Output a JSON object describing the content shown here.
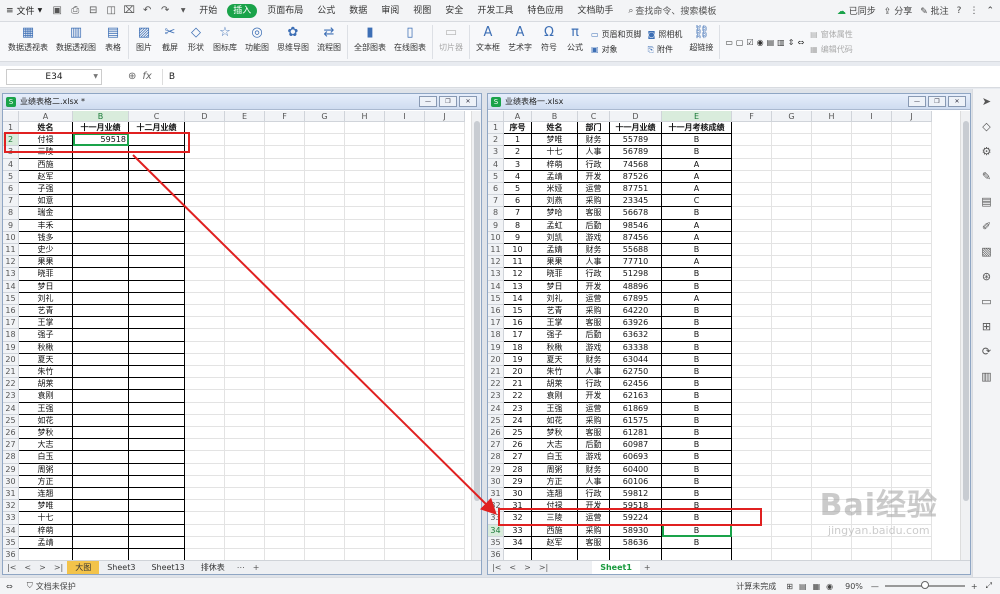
{
  "menubar": {
    "file_label": "文件",
    "tabs": [
      "开始",
      "插入",
      "页面布局",
      "公式",
      "数据",
      "审阅",
      "视图",
      "安全",
      "开发工具",
      "特色应用",
      "文档助手"
    ],
    "active_tab": "插入",
    "search_label": "查找命令、搜索模板",
    "sync_label": "已同步",
    "share_label": "分享",
    "comment_label": "批注"
  },
  "ribbon": {
    "buttons": [
      "数据透视表",
      "数据透视图",
      "表格",
      "图片",
      "截屏",
      "形状",
      "图标库",
      "功能图",
      "思维导图",
      "流程图",
      "全部图表",
      "在线图表",
      "切片器",
      "文本框",
      "艺术字",
      "符号",
      "公式"
    ],
    "small_items": [
      "页眉和页脚",
      "对象",
      "照相机",
      "附件",
      "超链接",
      "窗体属性",
      "编辑代码"
    ]
  },
  "formula_bar": {
    "cell_ref": "E34",
    "value": "B"
  },
  "left_window": {
    "title": "业绩表格二.xlsx *",
    "col_letters": [
      "A",
      "B",
      "C",
      "D",
      "E",
      "F",
      "G",
      "H",
      "I",
      "J"
    ],
    "headers": [
      "姓名",
      "十一月业绩",
      "十二月业绩"
    ],
    "rows": [
      [
        "付禄",
        "59518"
      ],
      [
        "三陵",
        ""
      ],
      [
        "西施",
        ""
      ],
      [
        "赵军",
        ""
      ],
      [
        "子强",
        ""
      ],
      [
        "如意",
        ""
      ],
      [
        "瑞金",
        ""
      ],
      [
        "丰禾",
        ""
      ],
      [
        "钱多",
        ""
      ],
      [
        "史少",
        ""
      ],
      [
        "果果",
        ""
      ],
      [
        "晓菲",
        ""
      ],
      [
        "梦日",
        ""
      ],
      [
        "刘礼",
        ""
      ],
      [
        "艺青",
        ""
      ],
      [
        "王掌",
        ""
      ],
      [
        "强子",
        ""
      ],
      [
        "秋楸",
        ""
      ],
      [
        "夏天",
        ""
      ],
      [
        "朱竹",
        ""
      ],
      [
        "胡莱",
        ""
      ],
      [
        "袁刚",
        ""
      ],
      [
        "王强",
        ""
      ],
      [
        "如花",
        ""
      ],
      [
        "梦秋",
        ""
      ],
      [
        "大志",
        ""
      ],
      [
        "白玉",
        ""
      ],
      [
        "周粥",
        ""
      ],
      [
        "方正",
        ""
      ],
      [
        "连翘",
        ""
      ],
      [
        "梦唯",
        ""
      ],
      [
        "十七",
        ""
      ],
      [
        "梓萌",
        ""
      ],
      [
        "孟靖",
        ""
      ]
    ],
    "sheet_tabs": [
      "大图",
      "Sheet3",
      "Sheet13",
      "排休表"
    ],
    "active_sheet": "大图"
  },
  "right_window": {
    "title": "业绩表格一.xlsx",
    "col_letters": [
      "A",
      "B",
      "C",
      "D",
      "E",
      "F",
      "G",
      "H",
      "I",
      "J"
    ],
    "headers": [
      "序号",
      "姓名",
      "部门",
      "十一月业绩",
      "十一月考核成绩"
    ],
    "rows": [
      [
        "1",
        "梦唯",
        "财务",
        "55789",
        "B"
      ],
      [
        "2",
        "十七",
        "人事",
        "56789",
        "B"
      ],
      [
        "3",
        "梓萌",
        "行政",
        "74568",
        "A"
      ],
      [
        "4",
        "孟靖",
        "开发",
        "87526",
        "A"
      ],
      [
        "5",
        "米娅",
        "运营",
        "87751",
        "A"
      ],
      [
        "6",
        "刘燕",
        "采购",
        "23345",
        "C"
      ],
      [
        "7",
        "梦哈",
        "客服",
        "56678",
        "B"
      ],
      [
        "8",
        "孟虹",
        "后勤",
        "98546",
        "A"
      ],
      [
        "9",
        "刘凯",
        "游戏",
        "87456",
        "A"
      ],
      [
        "10",
        "孟婧",
        "财务",
        "55688",
        "B"
      ],
      [
        "11",
        "果果",
        "人事",
        "77710",
        "A"
      ],
      [
        "12",
        "晓菲",
        "行政",
        "51298",
        "B"
      ],
      [
        "13",
        "梦日",
        "开发",
        "48896",
        "B"
      ],
      [
        "14",
        "刘礼",
        "运营",
        "67895",
        "A"
      ],
      [
        "15",
        "艺青",
        "采购",
        "64220",
        "B"
      ],
      [
        "16",
        "王掌",
        "客服",
        "63926",
        "B"
      ],
      [
        "17",
        "强子",
        "后勤",
        "63632",
        "B"
      ],
      [
        "18",
        "秋楸",
        "游戏",
        "63338",
        "B"
      ],
      [
        "19",
        "夏天",
        "财务",
        "63044",
        "B"
      ],
      [
        "20",
        "朱竹",
        "人事",
        "62750",
        "B"
      ],
      [
        "21",
        "胡莱",
        "行政",
        "62456",
        "B"
      ],
      [
        "22",
        "袁刚",
        "开发",
        "62163",
        "B"
      ],
      [
        "23",
        "王强",
        "运营",
        "61869",
        "B"
      ],
      [
        "24",
        "如花",
        "采购",
        "61575",
        "B"
      ],
      [
        "25",
        "梦秋",
        "客服",
        "61281",
        "B"
      ],
      [
        "26",
        "大志",
        "后勤",
        "60987",
        "B"
      ],
      [
        "27",
        "白玉",
        "游戏",
        "60693",
        "B"
      ],
      [
        "28",
        "周粥",
        "财务",
        "60400",
        "B"
      ],
      [
        "29",
        "方正",
        "人事",
        "60106",
        "B"
      ],
      [
        "30",
        "连翘",
        "行政",
        "59812",
        "B"
      ],
      [
        "31",
        "付禄",
        "开发",
        "59518",
        "B"
      ],
      [
        "32",
        "三陵",
        "运营",
        "59224",
        "B"
      ],
      [
        "33",
        "西施",
        "采购",
        "58930",
        "B"
      ],
      [
        "34",
        "赵军",
        "客服",
        "58636",
        "B"
      ]
    ],
    "sheet_tabs": [
      "Sheet1"
    ],
    "active_sheet": "Sheet1"
  },
  "statusbar": {
    "protect_label": "文档未保护",
    "calc_label": "计算未完成",
    "zoom": "90%"
  },
  "watermark": {
    "brand": "Bai经验",
    "url": "jingyan.baidu.com"
  }
}
